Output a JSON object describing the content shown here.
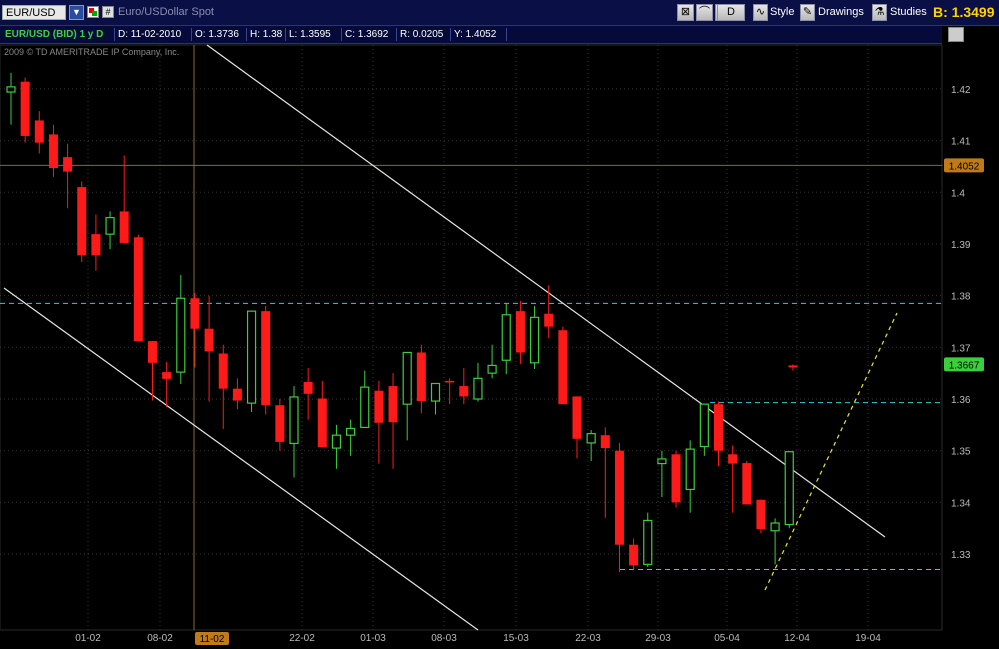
{
  "toolbar": {
    "symbol": "EUR/USD",
    "description": "Euro/USDollar Spot",
    "aggregation_label": "D",
    "style_label": "Style",
    "drawings_label": "Drawings",
    "studies_label": "Studies",
    "bid_text": "B: 1.3499"
  },
  "status_bar": {
    "title": "EUR/USD (BID) 1 y D",
    "date": "D: 11-02-2010",
    "open": "O: 1.3736",
    "high": "H: 1.38",
    "low": "L: 1.3595",
    "close": "C: 1.3692",
    "range": "R: 0.0205",
    "y": "Y: 1.4052"
  },
  "copyright": "2009 © TD AMERITRADE IP Company, Inc.",
  "colors": {
    "up": "#3ccf3c",
    "down": "#ff1a1a",
    "background": "#000000",
    "grid": "#333333",
    "crosshair": "#8a6a2a",
    "dashed_level": "#30d0d0",
    "projection": "#e8e830"
  },
  "chart_data": {
    "type": "candlestick",
    "yticks": [
      "1.42",
      "1.41",
      "1.4",
      "1.39",
      "1.38",
      "1.37",
      "1.36",
      "1.35",
      "1.34",
      "1.33"
    ],
    "ylim": [
      1.3153,
      1.4285
    ],
    "xticks": [
      "01-02",
      "08-02",
      "11-02",
      "22-02",
      "01-03",
      "08-03",
      "15-03",
      "22-03",
      "29-03",
      "05-04",
      "12-04",
      "19-04"
    ],
    "crosshair_x_label": "11-02",
    "crosshair_price_label": "1.4052",
    "last_price_label": "1.3667",
    "crosshair_price": 1.4052,
    "last_price": 1.3667,
    "candles": [
      {
        "o": 1.4194,
        "h": 1.4231,
        "l": 1.4131,
        "c": 1.4204
      },
      {
        "o": 1.4214,
        "h": 1.4222,
        "l": 1.4096,
        "c": 1.4109
      },
      {
        "o": 1.4139,
        "h": 1.4157,
        "l": 1.4075,
        "c": 1.4096
      },
      {
        "o": 1.4112,
        "h": 1.4131,
        "l": 1.403,
        "c": 1.4047
      },
      {
        "o": 1.4068,
        "h": 1.4094,
        "l": 1.3969,
        "c": 1.404
      },
      {
        "o": 1.401,
        "h": 1.4021,
        "l": 1.3865,
        "c": 1.3878
      },
      {
        "o": 1.3919,
        "h": 1.3957,
        "l": 1.3848,
        "c": 1.3878
      },
      {
        "o": 1.3919,
        "h": 1.3963,
        "l": 1.389,
        "c": 1.3951
      },
      {
        "o": 1.3963,
        "h": 1.4071,
        "l": 1.3915,
        "c": 1.3902
      },
      {
        "o": 1.3913,
        "h": 1.3918,
        "l": 1.3765,
        "c": 1.3712
      },
      {
        "o": 1.3712,
        "h": 1.3697,
        "l": 1.3597,
        "c": 1.367
      },
      {
        "o": 1.3652,
        "h": 1.3672,
        "l": 1.3584,
        "c": 1.3639
      },
      {
        "o": 1.3652,
        "h": 1.384,
        "l": 1.3629,
        "c": 1.3795
      },
      {
        "o": 1.3795,
        "h": 1.3805,
        "l": 1.3661,
        "c": 1.3736
      },
      {
        "o": 1.3736,
        "h": 1.38,
        "l": 1.3595,
        "c": 1.3692
      },
      {
        "o": 1.3688,
        "h": 1.3705,
        "l": 1.3542,
        "c": 1.362
      },
      {
        "o": 1.362,
        "h": 1.364,
        "l": 1.358,
        "c": 1.3597
      },
      {
        "o": 1.3592,
        "h": 1.373,
        "l": 1.3575,
        "c": 1.377
      },
      {
        "o": 1.377,
        "h": 1.378,
        "l": 1.357,
        "c": 1.3588
      },
      {
        "o": 1.3588,
        "h": 1.36,
        "l": 1.35,
        "c": 1.3517
      },
      {
        "o": 1.3514,
        "h": 1.3625,
        "l": 1.3448,
        "c": 1.3604
      },
      {
        "o": 1.3633,
        "h": 1.366,
        "l": 1.356,
        "c": 1.361
      },
      {
        "o": 1.3601,
        "h": 1.3635,
        "l": 1.351,
        "c": 1.3507
      },
      {
        "o": 1.3505,
        "h": 1.355,
        "l": 1.3465,
        "c": 1.353
      },
      {
        "o": 1.353,
        "h": 1.356,
        "l": 1.349,
        "c": 1.3543
      },
      {
        "o": 1.3545,
        "h": 1.3655,
        "l": 1.355,
        "c": 1.3623
      },
      {
        "o": 1.3616,
        "h": 1.3635,
        "l": 1.3475,
        "c": 1.3554
      },
      {
        "o": 1.3625,
        "h": 1.365,
        "l": 1.3465,
        "c": 1.3555
      },
      {
        "o": 1.359,
        "h": 1.366,
        "l": 1.352,
        "c": 1.369
      },
      {
        "o": 1.369,
        "h": 1.3705,
        "l": 1.3572,
        "c": 1.3596
      },
      {
        "o": 1.3596,
        "h": 1.362,
        "l": 1.357,
        "c": 1.363
      },
      {
        "o": 1.3635,
        "h": 1.364,
        "l": 1.359,
        "c": 1.3632
      },
      {
        "o": 1.3625,
        "h": 1.366,
        "l": 1.359,
        "c": 1.3605
      },
      {
        "o": 1.36,
        "h": 1.367,
        "l": 1.3595,
        "c": 1.364
      },
      {
        "o": 1.365,
        "h": 1.3705,
        "l": 1.364,
        "c": 1.3665
      },
      {
        "o": 1.3675,
        "h": 1.3785,
        "l": 1.3648,
        "c": 1.3763
      },
      {
        "o": 1.377,
        "h": 1.379,
        "l": 1.3668,
        "c": 1.369
      },
      {
        "o": 1.367,
        "h": 1.378,
        "l": 1.3658,
        "c": 1.3758
      },
      {
        "o": 1.3765,
        "h": 1.382,
        "l": 1.3718,
        "c": 1.374
      },
      {
        "o": 1.3733,
        "h": 1.374,
        "l": 1.359,
        "c": 1.359
      },
      {
        "o": 1.3605,
        "h": 1.36,
        "l": 1.3485,
        "c": 1.3523
      },
      {
        "o": 1.3515,
        "h": 1.354,
        "l": 1.348,
        "c": 1.3533
      },
      {
        "o": 1.353,
        "h": 1.3545,
        "l": 1.337,
        "c": 1.3505
      },
      {
        "o": 1.35,
        "h": 1.3515,
        "l": 1.3265,
        "c": 1.3318
      },
      {
        "o": 1.3318,
        "h": 1.333,
        "l": 1.327,
        "c": 1.3278
      },
      {
        "o": 1.328,
        "h": 1.338,
        "l": 1.3275,
        "c": 1.3365
      },
      {
        "o": 1.3475,
        "h": 1.35,
        "l": 1.341,
        "c": 1.3484
      },
      {
        "o": 1.3493,
        "h": 1.35,
        "l": 1.339,
        "c": 1.34
      },
      {
        "o": 1.3425,
        "h": 1.352,
        "l": 1.338,
        "c": 1.3503
      },
      {
        "o": 1.3508,
        "h": 1.359,
        "l": 1.349,
        "c": 1.359
      },
      {
        "o": 1.359,
        "h": 1.3595,
        "l": 1.347,
        "c": 1.35
      },
      {
        "o": 1.3493,
        "h": 1.351,
        "l": 1.338,
        "c": 1.3475
      },
      {
        "o": 1.3476,
        "h": 1.348,
        "l": 1.341,
        "c": 1.3396
      },
      {
        "o": 1.3405,
        "h": 1.3405,
        "l": 1.334,
        "c": 1.3348
      },
      {
        "o": 1.3345,
        "h": 1.3369,
        "l": 1.328,
        "c": 1.336
      },
      {
        "o": 1.3357,
        "h": 1.335,
        "l": 1.335,
        "c": 1.3498
      },
      {
        "o": 1.3665,
        "h": 1.3667,
        "l": 1.3655,
        "c": 1.3661
      }
    ]
  }
}
